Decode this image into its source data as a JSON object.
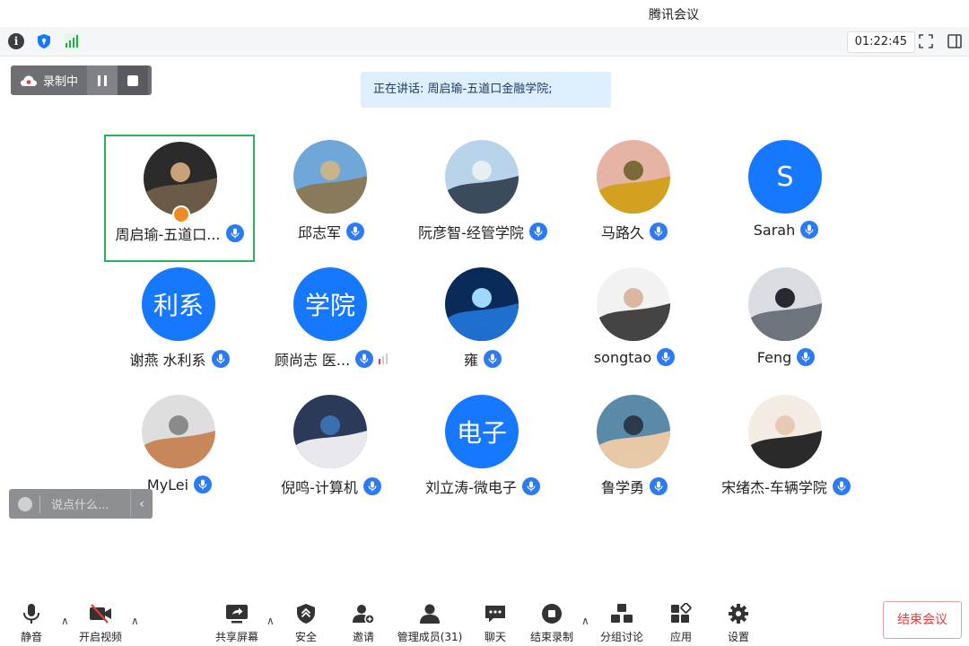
{
  "window": {
    "title": "腾讯会议"
  },
  "status": {
    "timer": "01:22:45"
  },
  "recording": {
    "label": "录制中"
  },
  "speaking": {
    "text": "正在讲话: 周启瑜-五道口金融学院;"
  },
  "participants": [
    {
      "name": "周启瑜-五道口...",
      "avatar": "photo",
      "host": true,
      "active": true
    },
    {
      "name": "邱志军",
      "avatar": "photo"
    },
    {
      "name": "阮彦智-经管学院",
      "avatar": "photo"
    },
    {
      "name": "马路久",
      "avatar": "photo"
    },
    {
      "name": "Sarah",
      "avatar": "text",
      "avatar_text": "S"
    },
    {
      "name": "谢燕  水利系",
      "avatar": "text",
      "avatar_text": "利系"
    },
    {
      "name": "顾尚志  医...",
      "avatar": "text",
      "avatar_text": "学院"
    },
    {
      "name": "雍",
      "avatar": "photo"
    },
    {
      "name": "songtao",
      "avatar": "photo"
    },
    {
      "name": "Feng",
      "avatar": "photo"
    },
    {
      "name": "MyLei",
      "avatar": "photo"
    },
    {
      "name": "倪鸣-计算机",
      "avatar": "photo"
    },
    {
      "name": "刘立涛-微电子",
      "avatar": "text",
      "avatar_text": "电子"
    },
    {
      "name": "鲁学勇",
      "avatar": "photo"
    },
    {
      "name": "宋绪杰-车辆学院",
      "avatar": "photo"
    }
  ],
  "chat": {
    "placeholder": "说点什么..."
  },
  "toolbar": {
    "mute": "静音",
    "video": "开启视频",
    "share": "共享屏幕",
    "security": "安全",
    "invite": "邀请",
    "members": "管理成员(31)",
    "chat": "聊天",
    "end_record": "结束录制",
    "breakout": "分组讨论",
    "apps": "应用",
    "settings": "设置",
    "end_meeting": "结束会议"
  },
  "colors": {
    "accent": "#1677ff",
    "active_border": "#29b35b",
    "danger": "#e23b3b"
  }
}
